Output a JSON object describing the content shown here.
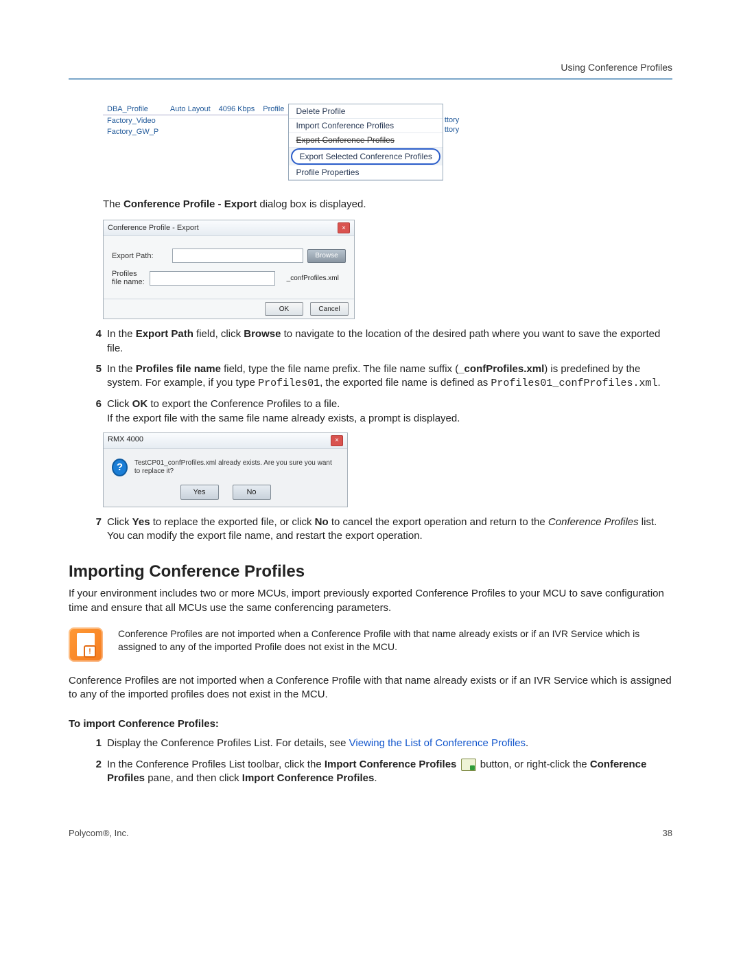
{
  "header": {
    "title": "Using Conference Profiles"
  },
  "menu_shot": {
    "left_rows": [
      {
        "name": "DBA_Profile",
        "layout": "Auto Layout",
        "rate": "4096 Kbps",
        "type": "Profile"
      },
      {
        "name": "Factory_Video"
      },
      {
        "name": "Factory_GW_P"
      }
    ],
    "right_labels": [
      "ttory",
      "ttory"
    ],
    "menu_items": {
      "delete": "Delete Profile",
      "import": "Import Conference Profiles",
      "export": "Export Conference Profiles",
      "export_selected": "Export Selected Conference Profiles",
      "properties": "Profile Properties"
    }
  },
  "intro_line": {
    "pre": "The ",
    "bold": "Conference Profile - Export",
    "post": " dialog box is displayed."
  },
  "export_dialog": {
    "title": "Conference Profile - Export",
    "labels": {
      "path": "Export Path:",
      "filename": "Profiles file name:"
    },
    "suffix": "_confProfiles.xml",
    "buttons": {
      "browse": "Browse",
      "ok": "OK",
      "cancel": "Cancel"
    }
  },
  "steps_a": {
    "s4": {
      "num": "4",
      "pre": "In the ",
      "b1": "Export Path",
      "mid1": " field, click ",
      "b2": "Browse",
      "post": " to navigate to the location of the desired path where you want to save the exported file."
    },
    "s5": {
      "num": "5",
      "pre": "In the ",
      "b1": "Profiles file name",
      "mid1": " field, type the file name prefix. The file name suffix (",
      "b2": "_confProfiles.xml",
      "mid2": ") is predefined by the system. For example, if you type ",
      "code1": "Profiles01",
      "mid3": ", the exported file name is defined as ",
      "code2": "Profiles01_confProfiles.xml",
      "post": "."
    },
    "s6": {
      "num": "6",
      "pre": "Click ",
      "b1": "OK",
      "post": " to export the Conference Profiles to a file.",
      "line2": "If the export file with the same file name already exists, a prompt is displayed."
    }
  },
  "prompt_dialog": {
    "title": "RMX 4000",
    "message": "TestCP01_confProfiles.xml already exists. Are you sure you want to replace it?",
    "yes": "Yes",
    "no": "No"
  },
  "steps_b": {
    "s7": {
      "num": "7",
      "pre": "Click ",
      "b1": "Yes",
      "mid1": " to replace the exported file, or click ",
      "b2": "No",
      "mid2": " to cancel the export operation and return to the ",
      "italic": "Conference Profiles",
      "post": " list. You can modify the export file name, and restart the export operation."
    }
  },
  "section2": {
    "title": "Importing Conference Profiles",
    "para1": "If your environment includes two or more MCUs, import previously exported Conference Profiles to your MCU to save configuration time and ensure that all MCUs use the same conferencing parameters.",
    "note": "Conference Profiles are not imported when a Conference Profile with that name already exists or if an IVR Service which is assigned to any of the imported Profile does not exist in the MCU.",
    "para2": "Conference Profiles are not imported when a Conference Profile with that name already exists or if an IVR Service which is assigned to any of the imported profiles does not exist in the MCU.",
    "subhead": "To import Conference Profiles:",
    "s1": {
      "num": "1",
      "pre": "Display the Conference Profiles List. For details, see ",
      "link": "Viewing the List of Conference Profiles",
      "post": "."
    },
    "s2": {
      "num": "2",
      "pre": "In the Conference Profiles List toolbar, click the ",
      "b1": "Import Conference Profiles",
      "mid1": " button, or right-click the ",
      "b2": "Conference Profiles",
      "mid2": " pane, and then click ",
      "b3": "Import Conference Profiles",
      "post": "."
    }
  },
  "footer": {
    "left": "Polycom®, Inc.",
    "right": "38"
  }
}
